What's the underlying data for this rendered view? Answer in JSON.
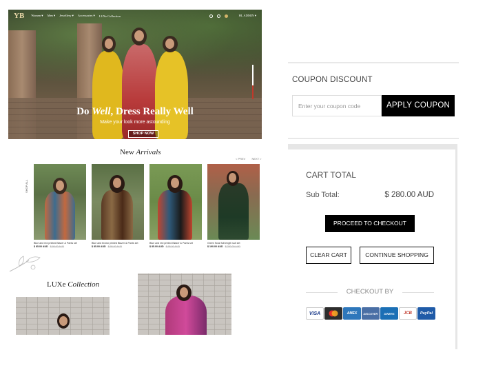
{
  "hero": {
    "logo": "YB",
    "nav_items": [
      "Women ▾",
      "Men ▾",
      "Jewellery ▾",
      "Accessories ▾",
      "LUXe Collection"
    ],
    "account_label": "HI, ADMIN ▾",
    "title_prefix": "Do ",
    "title_italic": "Well",
    "title_suffix": ", Dress Really Well",
    "subtitle": "Make your look more astounding",
    "cta": "SHOP NOW"
  },
  "new_arrivals": {
    "title_plain": "New ",
    "title_italic": "Arrivals",
    "prev": "< PREV",
    "next": "NEXT >",
    "side_label": "SHOP ALL",
    "products": [
      {
        "name": "Blue and red printed Blazer & Pants set",
        "price": "$ 85.00 AUD",
        "old_price": "$ 95.00 AUD"
      },
      {
        "name": "Blue and brown printed Blazer & Pants set",
        "price": "$ 85.00 AUD",
        "old_price": "$ 95.00 AUD"
      },
      {
        "name": "Blue and red printed Blazer & Pants set",
        "price": "$ 85.00 AUD",
        "old_price": "$ 95.00 AUD"
      },
      {
        "name": "Green floral full length suit set",
        "price": "$ 190.00 AUD",
        "old_price": "$ 250.00 AUD"
      }
    ]
  },
  "luxe": {
    "title_plain": "LUXe ",
    "title_italic": "Collection"
  },
  "coupon": {
    "title": "COUPON DISCOUNT",
    "placeholder": "Enter your coupon code",
    "apply_label": "APPLY COUPON"
  },
  "cart": {
    "title": "CART TOTAL",
    "subtotal_label": "Sub Total:",
    "subtotal_value": "$ 280.00 AUD",
    "checkout_label": "PROCEED TO CHECKOUT",
    "clear_label": "CLEAR CART",
    "continue_label": "CONTINUE SHOPPING",
    "checkout_by": "CHECKOUT BY",
    "payment_methods": [
      {
        "label": "VISA",
        "bg": "#ffffff",
        "fg": "#1a3a8a",
        "icon": "visa-icon"
      },
      {
        "label": "●●",
        "bg": "#2d2d2d",
        "fg": "#f0a020",
        "icon": "mastercard-icon"
      },
      {
        "label": "AMEX",
        "bg": "#2e77bb",
        "fg": "#ffffff",
        "icon": "amex-icon"
      },
      {
        "label": "DISCOVER",
        "bg": "#4a6fa5",
        "fg": "#ffffff",
        "icon": "discover-icon"
      },
      {
        "label": "DINERS",
        "bg": "#1b6fb5",
        "fg": "#ffffff",
        "icon": "diners-icon"
      },
      {
        "label": "JCB",
        "bg": "#ffffff",
        "fg": "#c0392b",
        "icon": "jcb-icon"
      },
      {
        "label": "PayPal",
        "bg": "#1f5ba8",
        "fg": "#ffffff",
        "icon": "paypal-icon"
      }
    ]
  }
}
